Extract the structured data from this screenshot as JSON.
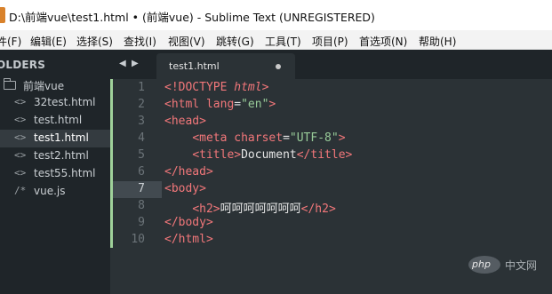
{
  "window": {
    "title": "D:\\前端vue\\test1.html • (前端vue) - Sublime Text (UNREGISTERED)"
  },
  "menu": [
    "件(F)",
    "编辑(E)",
    "选择(S)",
    "查找(I)",
    "视图(V)",
    "跳转(G)",
    "工具(T)",
    "项目(P)",
    "首选项(N)",
    "帮助(H)"
  ],
  "sidebar": {
    "header": "OLDERS",
    "folder": "前端vue",
    "files": [
      {
        "icon": "<>",
        "label": "32test.html",
        "active": false
      },
      {
        "icon": "<>",
        "label": "test.html",
        "active": false
      },
      {
        "icon": "<>",
        "label": "test1.html",
        "active": true
      },
      {
        "icon": "<>",
        "label": "test2.html",
        "active": false
      },
      {
        "icon": "<>",
        "label": "test55.html",
        "active": false
      },
      {
        "icon": "/*",
        "label": "vue.js",
        "active": false
      }
    ]
  },
  "tabs": {
    "back": "◀",
    "forward": "▶",
    "active_tab": "test1.html",
    "modified": true
  },
  "editor": {
    "current_line": 7,
    "line_numbers": [
      "1",
      "2",
      "3",
      "4",
      "5",
      "6",
      "7",
      "8",
      "9",
      "10"
    ],
    "lines": [
      [
        {
          "c": "t",
          "v": "<!DOCTYPE "
        },
        {
          "c": "kw",
          "v": "html"
        },
        {
          "c": "t",
          "v": ">"
        }
      ],
      [
        {
          "c": "t",
          "v": "<html "
        },
        {
          "c": "attr",
          "v": "lang"
        },
        {
          "c": "p",
          "v": "="
        },
        {
          "c": "str",
          "v": "\"en\""
        },
        {
          "c": "t",
          "v": ">"
        }
      ],
      [
        {
          "c": "t",
          "v": "<head>"
        }
      ],
      [
        {
          "c": "p",
          "v": "    "
        },
        {
          "c": "t",
          "v": "<meta "
        },
        {
          "c": "attr",
          "v": "charset"
        },
        {
          "c": "p",
          "v": "="
        },
        {
          "c": "str",
          "v": "\"UTF-8\""
        },
        {
          "c": "t",
          "v": ">"
        }
      ],
      [
        {
          "c": "p",
          "v": "    "
        },
        {
          "c": "t",
          "v": "<title>"
        },
        {
          "c": "txt",
          "v": "Document"
        },
        {
          "c": "t",
          "v": "</title>"
        }
      ],
      [
        {
          "c": "t",
          "v": "</head>"
        }
      ],
      [
        {
          "c": "t",
          "v": "<body>"
        }
      ],
      [
        {
          "c": "p",
          "v": "    "
        },
        {
          "c": "t",
          "v": "<h2>"
        },
        {
          "c": "txt",
          "v": "呵呵呵呵呵呵呵"
        },
        {
          "c": "t",
          "v": "</h2>"
        }
      ],
      [
        {
          "c": "t",
          "v": "</body>"
        }
      ],
      [
        {
          "c": "t",
          "v": "</html>"
        }
      ]
    ]
  },
  "watermark": {
    "logo": "php",
    "text": "中文网"
  },
  "colors": {
    "tag": "#f2777a",
    "string": "#99cc99",
    "text": "#e6e6e6",
    "editor_bg": "#2b3236",
    "sidebar_bg": "#1f2529",
    "modified_marker": "#9fd19a"
  }
}
